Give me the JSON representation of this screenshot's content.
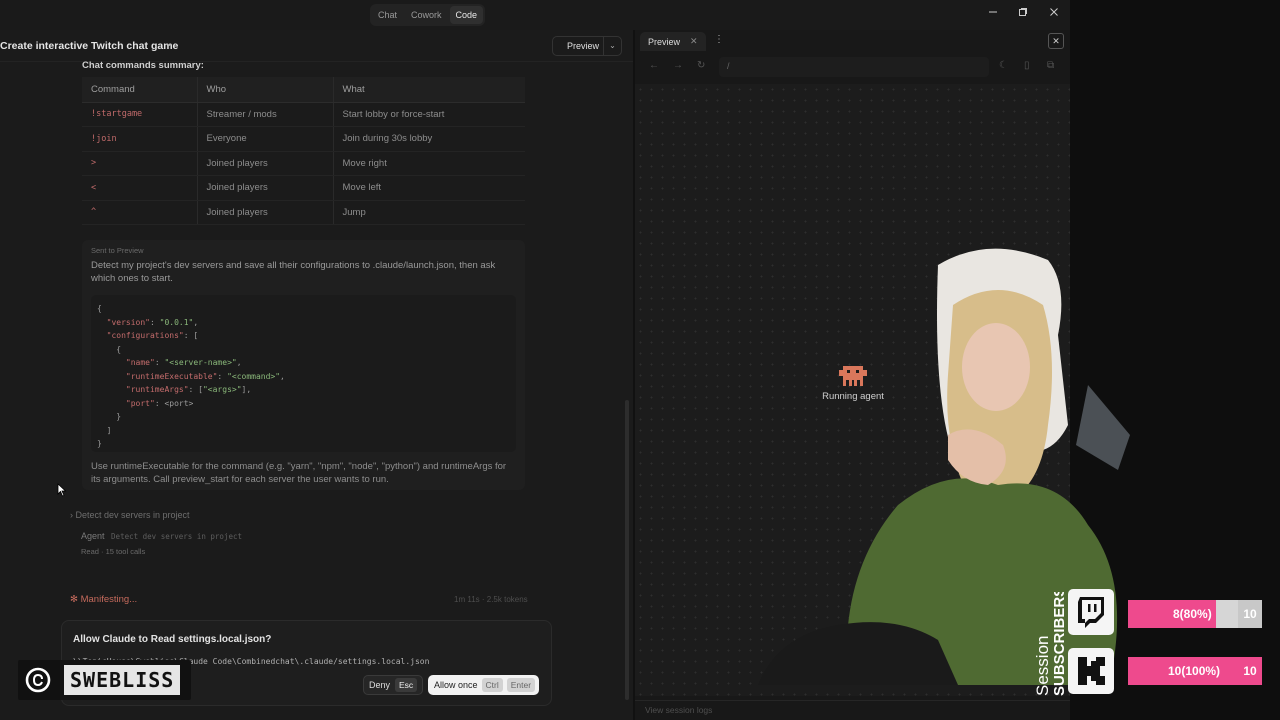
{
  "titlebar": {
    "modes": [
      {
        "label": "Chat",
        "active": false
      },
      {
        "label": "Cowork",
        "active": false
      },
      {
        "label": "Code",
        "active": true
      }
    ],
    "controls": [
      "minimize",
      "restore",
      "close"
    ]
  },
  "conversation": {
    "title": "Create interactive Twitch chat game",
    "preview_button": "Preview",
    "summary_title": "Chat commands summary:",
    "table": {
      "headers": [
        "Command",
        "Who",
        "What"
      ],
      "rows": [
        {
          "command": "!startgame",
          "who": "Streamer / mods",
          "what": "Start lobby or force-start"
        },
        {
          "command": "!join",
          "who": "Everyone",
          "what": "Join during 30s lobby"
        },
        {
          "command": ">",
          "who": "Joined players",
          "what": "Move right"
        },
        {
          "command": "<",
          "who": "Joined players",
          "what": "Move left"
        },
        {
          "command": "^",
          "who": "Joined players",
          "what": "Jump"
        }
      ]
    },
    "prompt": {
      "sent_label": "Sent to Preview",
      "text": "Detect my project's dev servers and save all their configurations to .claude/launch.json, then ask which ones to start.",
      "code_lines": [
        [
          {
            "t": "{",
            "c": ""
          }
        ],
        [
          {
            "t": "  ",
            "c": ""
          },
          {
            "t": "\"version\"",
            "c": "k"
          },
          {
            "t": ": ",
            "c": ""
          },
          {
            "t": "\"0.0.1\"",
            "c": "s"
          },
          {
            "t": ",",
            "c": ""
          }
        ],
        [
          {
            "t": "  ",
            "c": ""
          },
          {
            "t": "\"configurations\"",
            "c": "k"
          },
          {
            "t": ": [",
            "c": ""
          }
        ],
        [
          {
            "t": "    {",
            "c": ""
          }
        ],
        [
          {
            "t": "      ",
            "c": ""
          },
          {
            "t": "\"name\"",
            "c": "k"
          },
          {
            "t": ": ",
            "c": ""
          },
          {
            "t": "\"<server-name>\"",
            "c": "s"
          },
          {
            "t": ",",
            "c": ""
          }
        ],
        [
          {
            "t": "      ",
            "c": ""
          },
          {
            "t": "\"runtimeExecutable\"",
            "c": "k"
          },
          {
            "t": ": ",
            "c": ""
          },
          {
            "t": "\"<command>\"",
            "c": "s"
          },
          {
            "t": ",",
            "c": ""
          }
        ],
        [
          {
            "t": "      ",
            "c": ""
          },
          {
            "t": "\"runtimeArgs\"",
            "c": "k"
          },
          {
            "t": ": [",
            "c": ""
          },
          {
            "t": "\"<args>\"",
            "c": "s"
          },
          {
            "t": "],",
            "c": ""
          }
        ],
        [
          {
            "t": "      ",
            "c": ""
          },
          {
            "t": "\"port\"",
            "c": "k"
          },
          {
            "t": ": <port>",
            "c": ""
          }
        ],
        [
          {
            "t": "    }",
            "c": ""
          }
        ],
        [
          {
            "t": "  ]",
            "c": ""
          }
        ],
        [
          {
            "t": "}",
            "c": ""
          }
        ]
      ],
      "note": "Use runtimeExecutable for the command (e.g. \"yarn\", \"npm\", \"node\", \"python\") and runtimeArgs for its arguments. Call preview_start for each server the user wants to run."
    },
    "task": {
      "detect_label": "Detect dev servers in project",
      "agent_label": "Agent",
      "agent_detail": "Detect dev servers in project",
      "tool_calls": "Read · 15 tool calls"
    },
    "status": {
      "label": "Manifesting...",
      "meta": "1m 11s · 2.5k tokens"
    },
    "permission": {
      "title": "Allow Claude to Read settings.local.json?",
      "path": "\\\\TopicHouse\\Swebliss\\Claude Code\\Combinedchat\\.claude/settings.local.json",
      "deny_label": "Deny",
      "deny_key": "Esc",
      "allow_label": "Allow once",
      "allow_keys": [
        "Ctrl",
        "Enter"
      ]
    }
  },
  "preview": {
    "tab_label": "Preview",
    "url": "/",
    "running_label": "Running agent",
    "session_logs": "View session logs"
  },
  "overlay": {
    "brand_name": "SWEBLISS",
    "session_word": "Session",
    "subscribers_word": "SUBSCRIBERS",
    "goals": [
      {
        "platform": "twitch-icon",
        "label": "8(80%)",
        "target": "10",
        "fraction": 0.8
      },
      {
        "platform": "kick-icon",
        "label": "10(100%)",
        "target": "10",
        "fraction": 1.0
      }
    ],
    "colors": {
      "goal_fill": "#ee4a8d",
      "accent_red": "#c56a5c"
    }
  }
}
